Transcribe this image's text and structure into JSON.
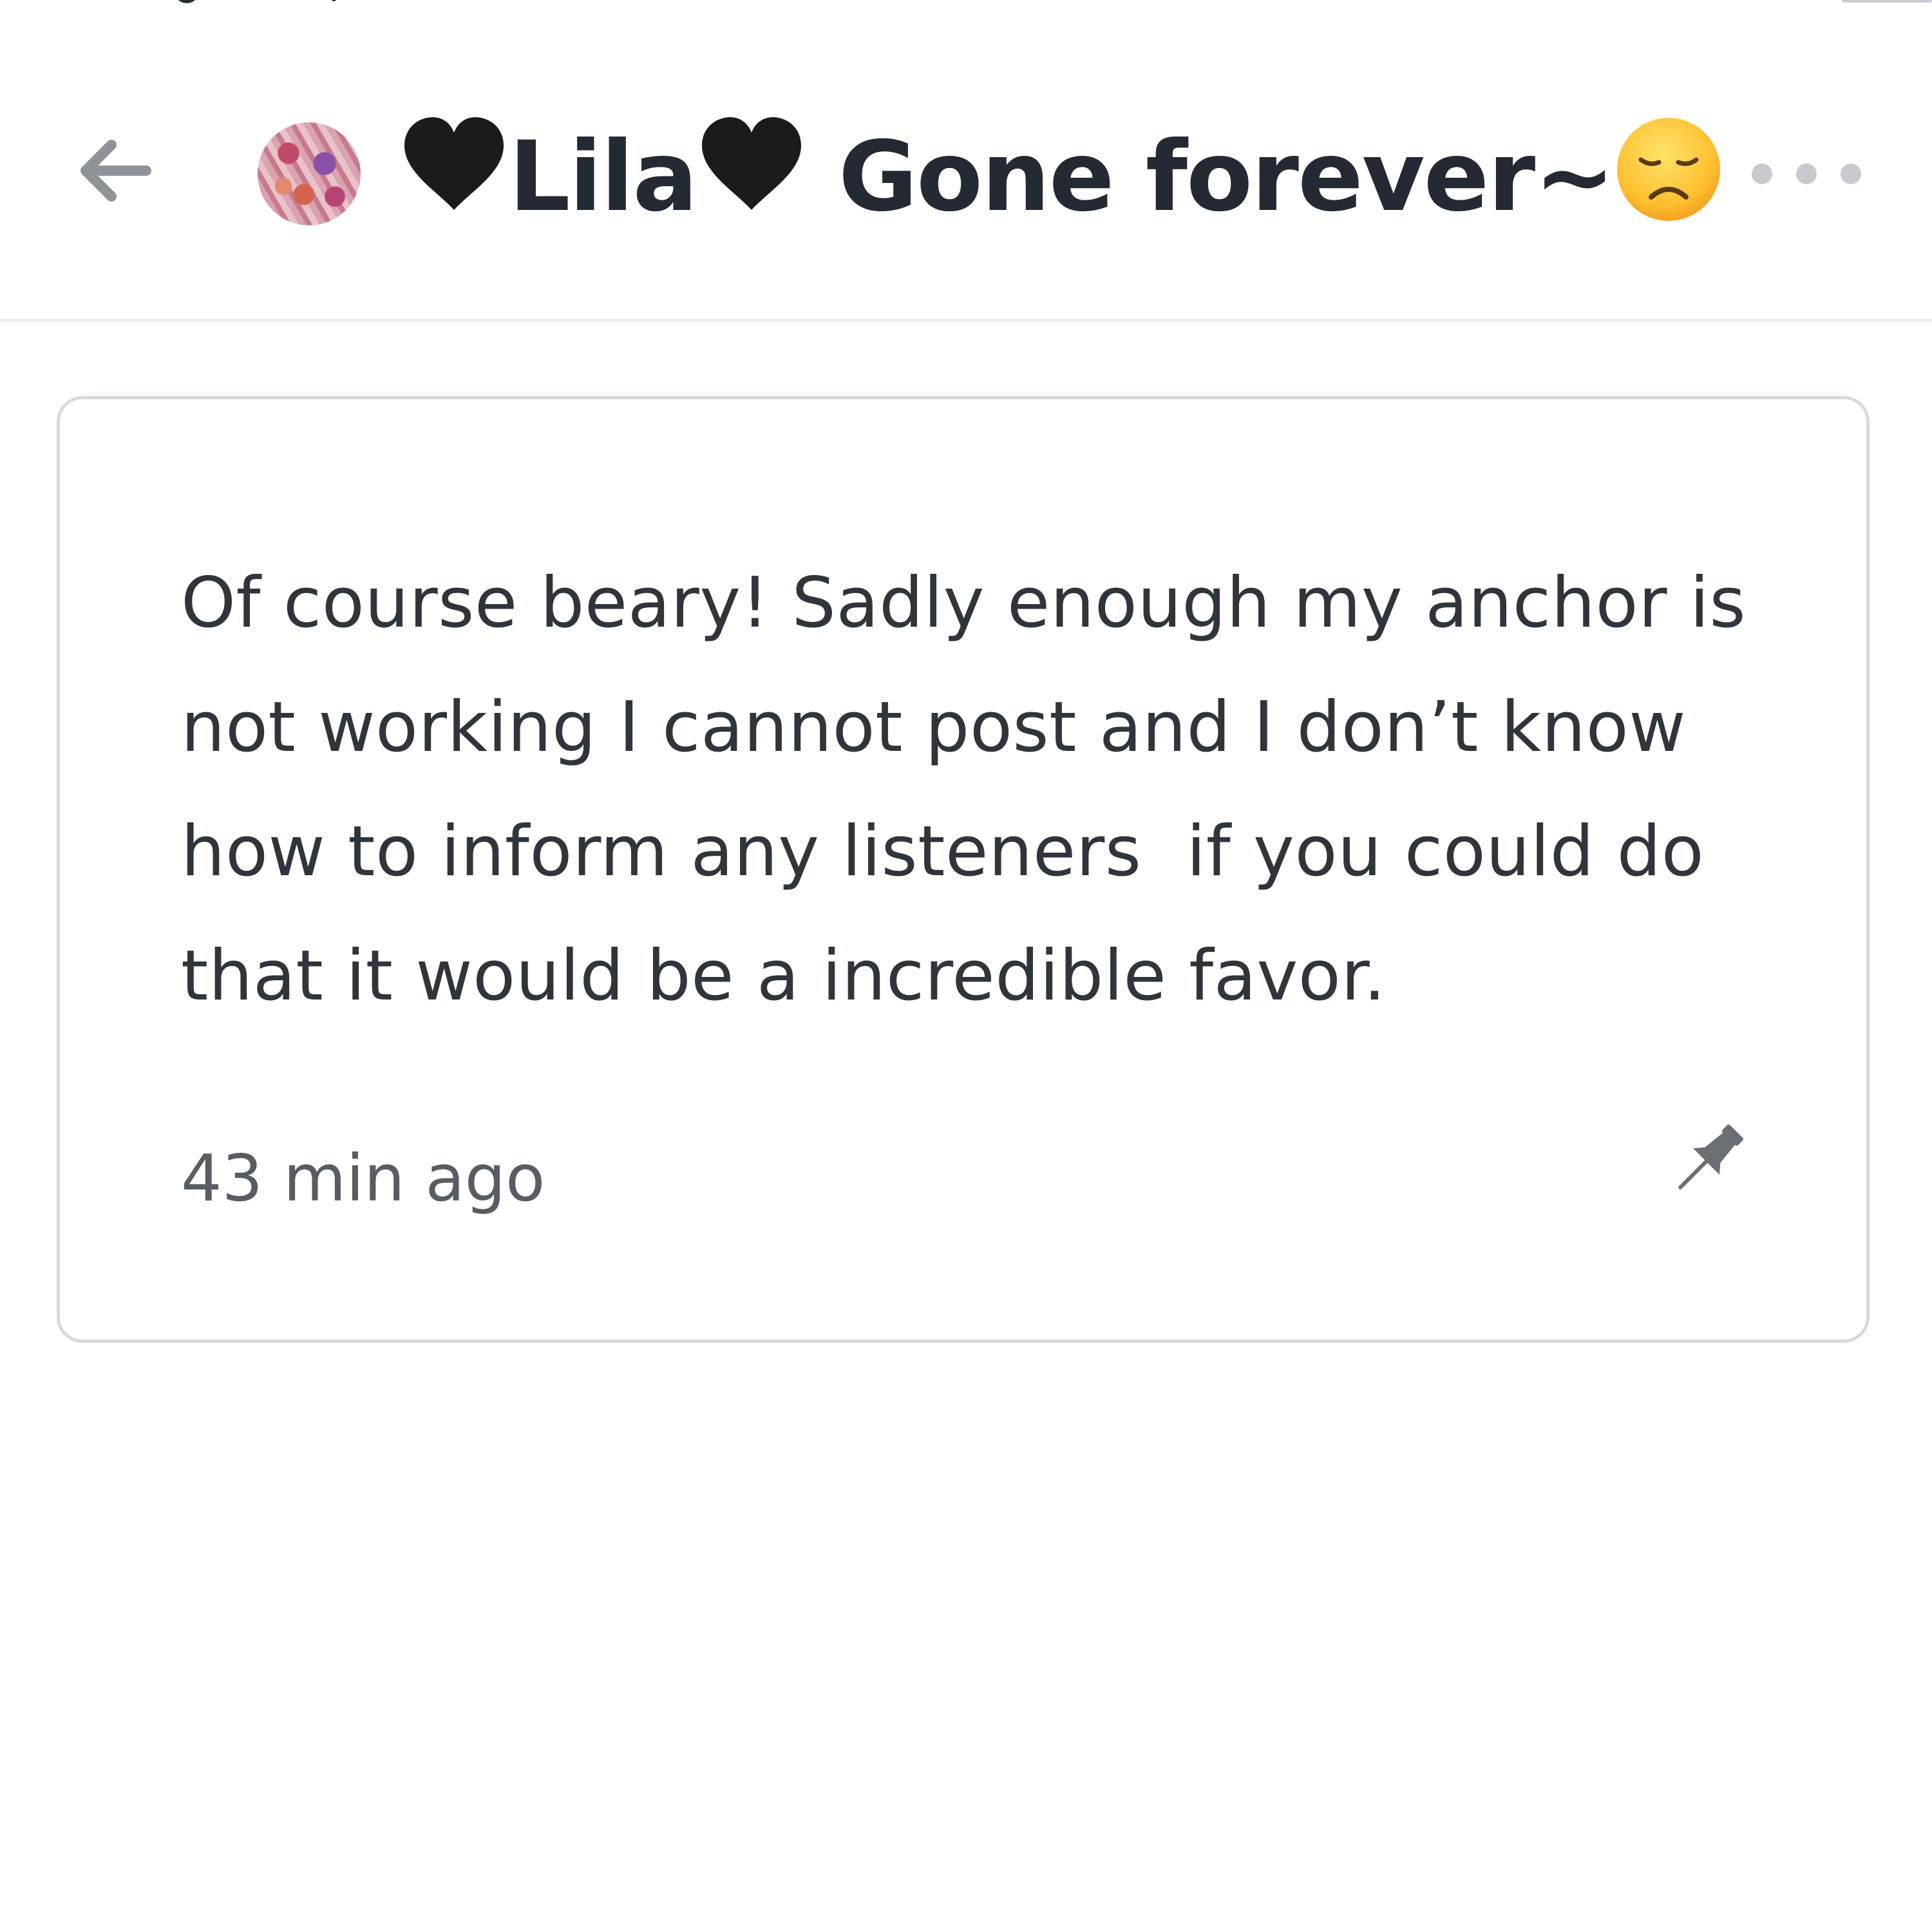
{
  "header": {
    "title_prefix": "Lila",
    "title_suffix": " Gone forever~",
    "back_icon": "arrow-left-icon",
    "more_icon": "more-horizontal-icon",
    "heart_icon": "black-heart-emoji",
    "sad_icon": "disappointed-face-emoji"
  },
  "message": {
    "text": "Of course beary! Sadly enough my anchor is not working I cannot post and I don’t know how to inform any listeners  if you could do that it would be a incredible favor.",
    "timestamp": "43 min ago",
    "pin_icon": "pin-icon"
  },
  "colors": {
    "title": "#232a33",
    "body_text": "#2f353c",
    "muted_text": "#575d64",
    "icon_gray": "#8e9399",
    "card_border": "#d7dade",
    "divider": "#eceef1"
  }
}
